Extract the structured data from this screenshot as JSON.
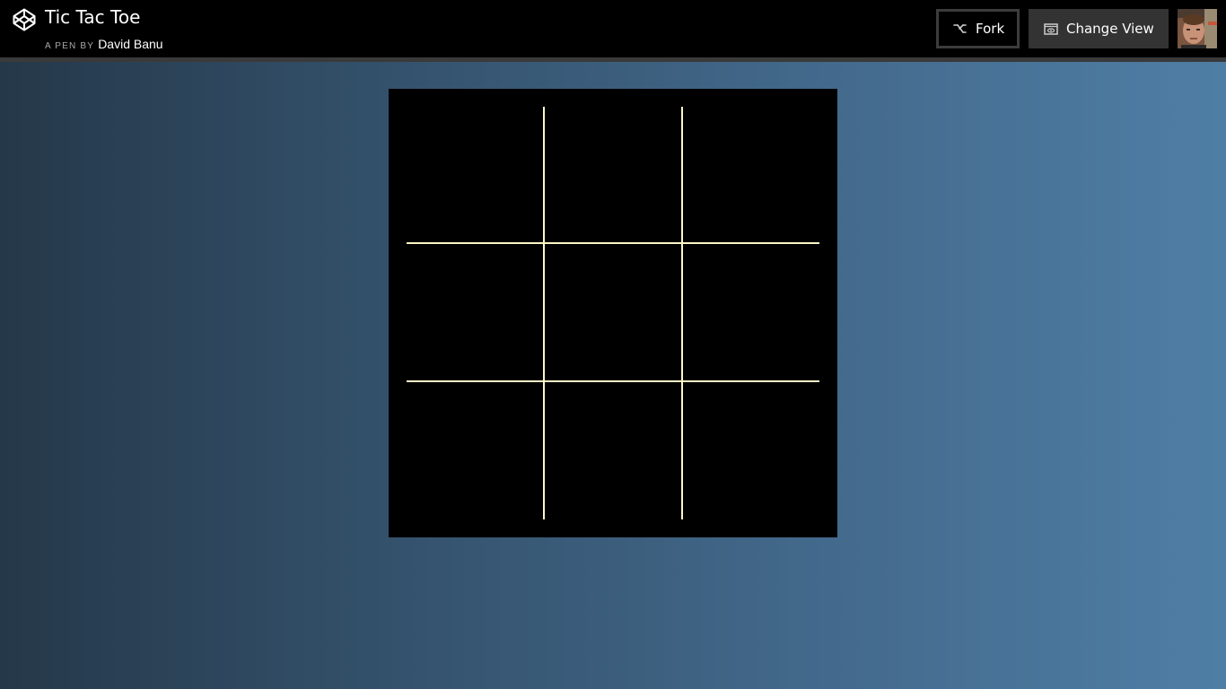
{
  "header": {
    "title": "Tic Tac Toe",
    "byline_label": "A PEN BY",
    "author": "David Banu",
    "logo_icon": "codepen-logo-icon"
  },
  "actions": {
    "fork_label": "Fork",
    "fork_icon": "fork-icon",
    "change_view_label": "Change View",
    "change_view_icon": "eye-icon"
  },
  "user": {
    "avatar": "user-avatar"
  },
  "game": {
    "grid_color": "#fdf6c6",
    "board_color": "#000000",
    "cells": [
      "",
      "",
      "",
      "",
      "",
      "",
      "",
      "",
      ""
    ]
  }
}
